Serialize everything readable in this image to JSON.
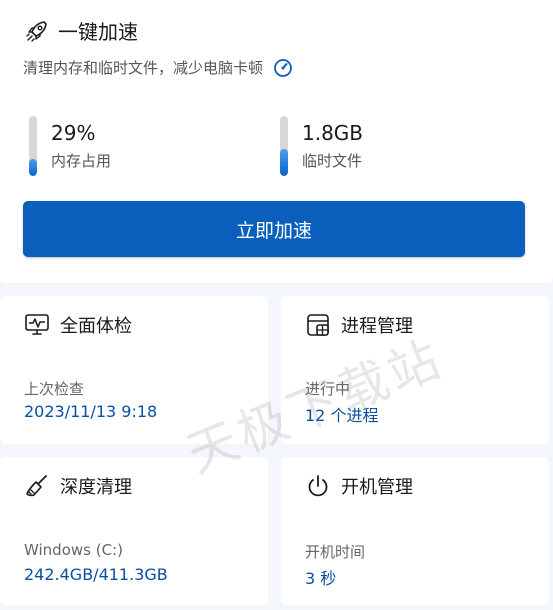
{
  "boost": {
    "title": "一键加速",
    "subtitle": "清理内存和临时文件，减少电脑卡顿",
    "memory": {
      "value": "29%",
      "label": "内存占用",
      "fill": 0.29
    },
    "temp": {
      "value": "1.8GB",
      "label": "临时文件",
      "fill": 0.45
    },
    "button_label": "立即加速"
  },
  "tiles": {
    "checkup": {
      "title": "全面体检",
      "caption": "上次检查",
      "detail": "2023/11/13 9:18"
    },
    "process": {
      "title": "进程管理",
      "caption": "进行中",
      "detail": "12 个进程"
    },
    "clean": {
      "title": "深度清理",
      "caption": "Windows (C:)",
      "detail": "242.4GB/411.3GB"
    },
    "startup": {
      "title": "开机管理",
      "caption": "开机时间",
      "detail": "3 秒"
    }
  },
  "watermark": "天极下载站",
  "colors": {
    "accent": "#0a5fbd",
    "link": "#0a4fa0"
  }
}
